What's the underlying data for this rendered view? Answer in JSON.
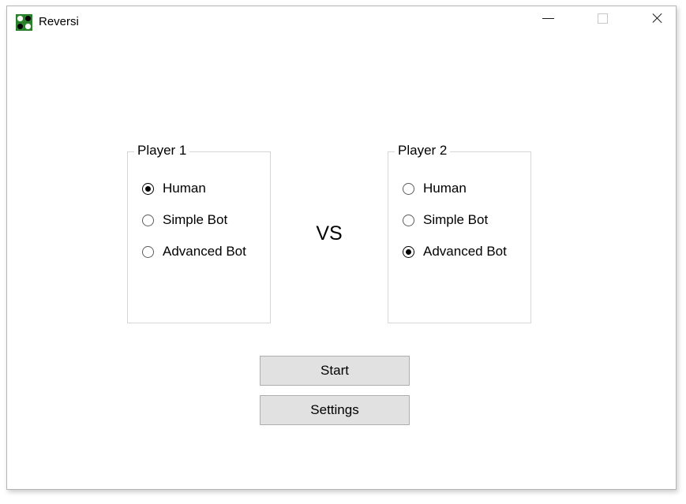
{
  "window": {
    "title": "Reversi",
    "icon": "reversi-board-icon",
    "controls": {
      "minimize_label": "minimize",
      "maximize_label": "maximize",
      "close_label": "close"
    }
  },
  "main": {
    "vs_label": "VS",
    "groups": [
      {
        "title": "Player 1",
        "options": [
          {
            "label": "Human",
            "selected": true
          },
          {
            "label": "Simple Bot",
            "selected": false
          },
          {
            "label": "Advanced Bot",
            "selected": false
          }
        ]
      },
      {
        "title": "Player 2",
        "options": [
          {
            "label": "Human",
            "selected": false
          },
          {
            "label": "Simple Bot",
            "selected": false
          },
          {
            "label": "Advanced Bot",
            "selected": true
          }
        ]
      }
    ],
    "buttons": {
      "start_label": "Start",
      "settings_label": "Settings"
    }
  },
  "colors": {
    "window_background": "#ffffff",
    "group_border": "#d6d6d6",
    "button_face": "#e1e1e1",
    "button_border": "#adadad",
    "icon_green": "#2c8a2c",
    "text": "#000000"
  }
}
